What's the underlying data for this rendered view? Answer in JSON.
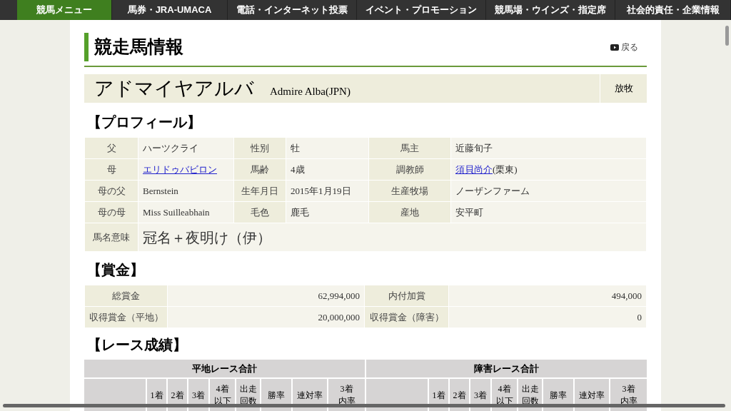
{
  "nav": {
    "items": [
      {
        "label": "競馬メニュー",
        "selected": true
      },
      {
        "label": "馬券・JRA-UMACA",
        "selected": false
      },
      {
        "label": "電話・インターネット投票",
        "selected": false
      },
      {
        "label": "イベント・プロモーション",
        "selected": false
      },
      {
        "label": "競馬場・ウインズ・指定席",
        "selected": false
      },
      {
        "label": "社会的責任・企業情報",
        "selected": false
      }
    ]
  },
  "page_title": "競走馬情報",
  "back_link": "戻る",
  "horse": {
    "name_ja": "アドマイヤアルバ",
    "name_en": "Admire Alba(JPN)",
    "status": "放牧"
  },
  "profile": {
    "heading": "【プロフィール】",
    "rows": [
      [
        {
          "label": "父",
          "value": [
            {
              "text": "ハーツクライ",
              "link": false
            }
          ]
        },
        {
          "label": "性別",
          "value": [
            {
              "text": "牡",
              "link": false
            }
          ]
        },
        {
          "label": "馬主",
          "value": [
            {
              "text": "近藤旬子",
              "link": false
            }
          ]
        }
      ],
      [
        {
          "label": "母",
          "value": [
            {
              "text": "エリドゥバビロン",
              "link": true
            }
          ]
        },
        {
          "label": "馬齢",
          "value": [
            {
              "text": "4歳",
              "link": false
            }
          ]
        },
        {
          "label": "調教師",
          "value": [
            {
              "text": "須貝尚介",
              "link": true
            },
            {
              "text": "(栗東)",
              "link": false
            }
          ]
        }
      ],
      [
        {
          "label": "母の父",
          "value": [
            {
              "text": "Bernstein",
              "link": false
            }
          ]
        },
        {
          "label": "生年月日",
          "value": [
            {
              "text": "2015年1月19日",
              "link": false
            }
          ]
        },
        {
          "label": "生産牧場",
          "value": [
            {
              "text": "ノーザンファーム",
              "link": false
            }
          ]
        }
      ],
      [
        {
          "label": "母の母",
          "value": [
            {
              "text": "Miss Suilleabhain",
              "link": false
            }
          ]
        },
        {
          "label": "毛色",
          "value": [
            {
              "text": "鹿毛",
              "link": false
            }
          ]
        },
        {
          "label": "産地",
          "value": [
            {
              "text": "安平町",
              "link": false
            }
          ]
        }
      ]
    ],
    "meaning": {
      "label": "馬名意味",
      "value": "冠名＋夜明け（伊）"
    }
  },
  "prize": {
    "heading": "【賞金】",
    "rows": [
      [
        {
          "label": "総賞金",
          "value": "62,994,000"
        },
        {
          "label": "内付加賞",
          "value": "494,000"
        }
      ],
      [
        {
          "label": "収得賞金（平地）",
          "value": "20,000,000"
        },
        {
          "label": "収得賞金（障害）",
          "value": "0"
        }
      ]
    ]
  },
  "results": {
    "heading": "【レース成績】",
    "groups": [
      {
        "title": "平地レース合計",
        "columns": [
          "1着",
          "2着",
          "3着",
          "4着以下",
          "出走回数",
          "勝率",
          "連対率",
          "3着内率"
        ]
      },
      {
        "title": "障害レース合計",
        "columns": [
          "1着",
          "2着",
          "3着",
          "4着以下",
          "出走回数",
          "勝率",
          "連対率",
          "3着内率"
        ]
      }
    ]
  }
}
